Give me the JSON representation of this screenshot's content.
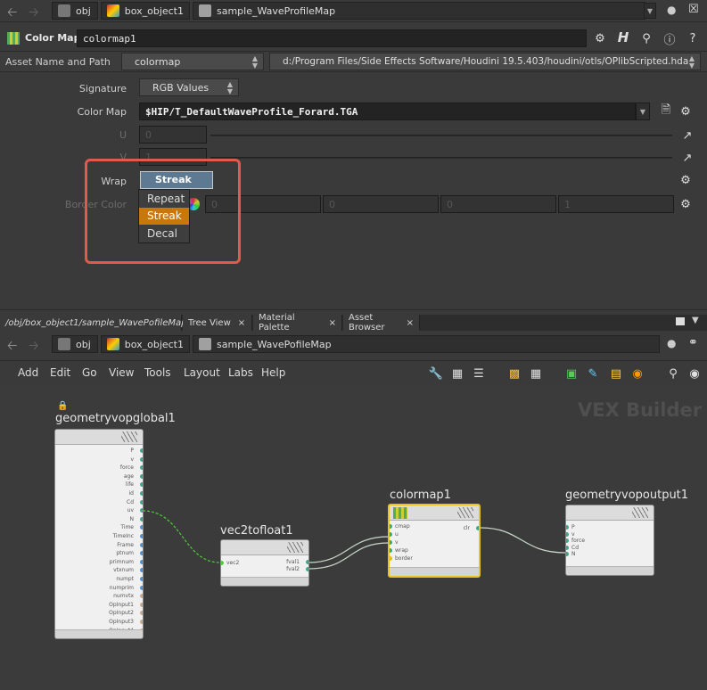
{
  "top_path": {
    "items": [
      "obj",
      "box_object1",
      "sample_WaveProfileMap"
    ]
  },
  "param_header": {
    "type_label": "Color Map",
    "node_name": "colormap1"
  },
  "asset_row": {
    "label": "Asset Name and Path",
    "asset_name": "colormap",
    "asset_path": "d:/Program Files/Side Effects Software/Houdini 19.5.403/houdini/otls/OPlibScripted.hda"
  },
  "params": {
    "signature_label": "Signature",
    "signature_value": "RGB Values",
    "colormap_label": "Color Map",
    "colormap_value": "$HIP/T_DefaultWaveProfile_Forard.TGA",
    "u_label": "U",
    "u_value": "0",
    "v_label": "V",
    "v_value": "1",
    "wrap_label": "Wrap",
    "wrap_value": "Streak",
    "border_label": "Border Color",
    "border_values": [
      "0",
      "0",
      "0",
      "1"
    ]
  },
  "wrap_menu": {
    "options": [
      "Repeat",
      "Streak",
      "Decal"
    ],
    "selected": "Streak"
  },
  "pane_tabs": [
    "/obj/box_object1/sample_WavePofileMap",
    "Tree View",
    "Material Palette",
    "Asset Browser"
  ],
  "network_path": {
    "items": [
      "obj",
      "box_object1",
      "sample_WavePofileMap"
    ]
  },
  "network_menu": [
    "Add",
    "Edit",
    "Go",
    "View",
    "Tools",
    "Layout",
    "Labs",
    "Help"
  ],
  "network_label": "VEX Builder",
  "nodes": {
    "global": {
      "name": "geometryvopglobal1",
      "outputs": [
        "P",
        "v",
        "force",
        "age",
        "life",
        "id",
        "Cd",
        "uv",
        "N",
        "Time",
        "TimeInc",
        "Frame",
        "ptnum",
        "primnum",
        "vtxnum",
        "numpt",
        "numprim",
        "numvtx",
        "OpInput1",
        "OpInput2",
        "OpInput3",
        "OpInput4"
      ]
    },
    "vec2": {
      "name": "vec2tofloat1",
      "input": "vec2",
      "outputs": [
        "fval1",
        "fval2"
      ]
    },
    "colormap": {
      "name": "colormap1",
      "inputs": [
        "cmap",
        "u",
        "v",
        "wrap",
        "border"
      ],
      "output": "clr"
    },
    "output": {
      "name": "geometryvopoutput1",
      "inputs": [
        "P",
        "v",
        "force",
        "Cd",
        "N"
      ]
    }
  },
  "colors": {
    "highlight": "#e05a4e",
    "selected_node": "#e8c320",
    "menu_selected": "#c8770a",
    "wire": "#c8d8c8"
  }
}
